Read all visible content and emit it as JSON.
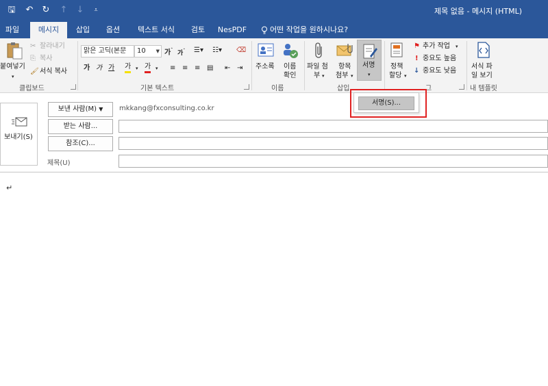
{
  "titlebar": {
    "title": "제목 없음  -  메시지 (HTML)",
    "quick_access": {
      "save_icon": "🖫",
      "undo_icon": "↶",
      "redo_icon": "↻",
      "up_icon": "↑",
      "down_icon": "↓",
      "customize_icon": "⩡"
    },
    "bg_color": "#2b579a"
  },
  "tabs": [
    {
      "label": "파일"
    },
    {
      "label": "메시지",
      "active": true
    },
    {
      "label": "삽입"
    },
    {
      "label": "옵션"
    },
    {
      "label": "텍스트 서식"
    },
    {
      "label": "검토"
    },
    {
      "label": "NesPDF"
    },
    {
      "label": "어떤 작업을 원하시나요?"
    }
  ],
  "ribbon": {
    "clipboard": {
      "paste": "붙여넣기",
      "cut": "잘라내기",
      "copy": "복사",
      "format_painter": "서식 복사",
      "group_label": "클립보드"
    },
    "basic_text": {
      "font_name": "맑은 고딕(본문",
      "font_size": "10",
      "bold": "가",
      "italic": "가",
      "underline": "가",
      "highlight": "가",
      "font_color": "가",
      "group_label": "기본 텍스트"
    },
    "names": {
      "address_book": "주소록",
      "check_names_line1": "이름",
      "check_names_line2": "확인",
      "group_label": "이름"
    },
    "include": {
      "attach_file_line1": "파일 첨",
      "attach_file_line2": "부",
      "attach_item_line1": "항목",
      "attach_item_line2": "첨부",
      "signature": "서명",
      "group_label": "삽입"
    },
    "tags": {
      "policy_line1": "정책",
      "policy_line2": "할당",
      "follow_up": "추가 작업",
      "high_importance": "중요도 높음",
      "low_importance": "중요도 낮음",
      "group_label_partial": "그"
    },
    "my_templates": {
      "view_templates_line1": "서식 파",
      "view_templates_line2": "일 보기",
      "group_label": "내 템플릿"
    }
  },
  "signature_dropdown": {
    "item": "서명(S)..."
  },
  "header": {
    "send": "보내기(S)",
    "from": "보낸 사람(M)",
    "from_email": "mkkang@fxconsulting.co.kr",
    "to": "받는 사람...",
    "cc": "참조(C)...",
    "subject_label": "제목(U)"
  },
  "body": {
    "caret_glyph": "↵"
  },
  "colors": {
    "accent": "#2b579a",
    "highlight_box": "#e02020",
    "ribbon_bg": "#f3f3f3"
  }
}
